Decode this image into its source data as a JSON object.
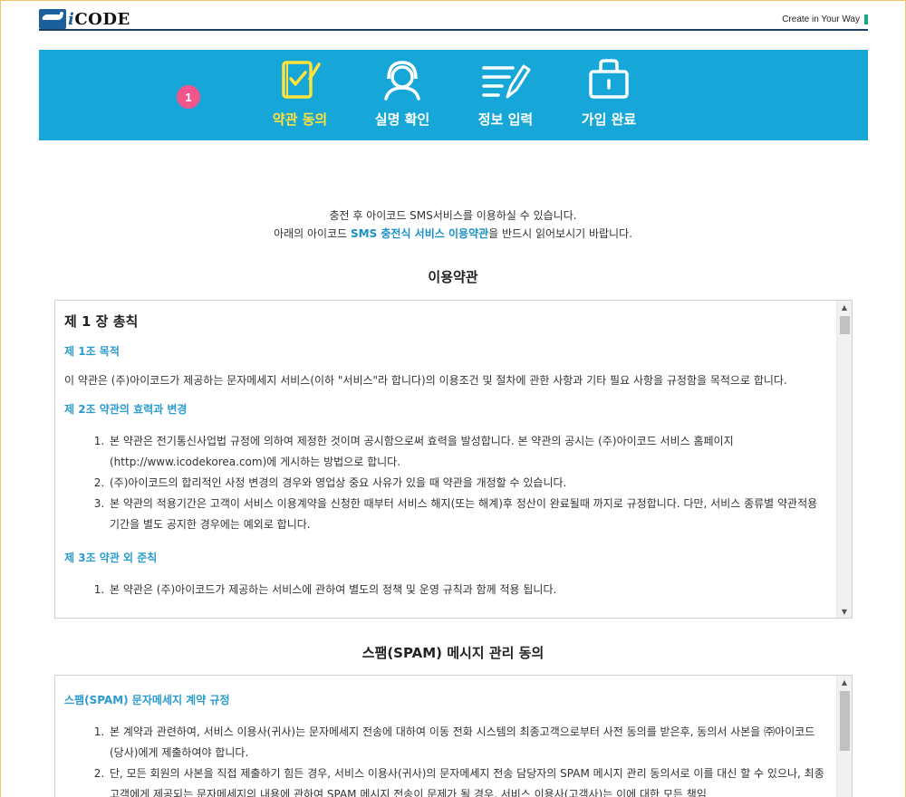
{
  "header": {
    "logo_i": "i",
    "logo_text": "CODE",
    "tagline": "Create in Your Way"
  },
  "steps": {
    "current_badge": "1",
    "items": [
      {
        "label": "약관 동의",
        "icon": "checklist-icon",
        "active": true
      },
      {
        "label": "실명 확인",
        "icon": "user-headset-icon",
        "active": false
      },
      {
        "label": "정보 입력",
        "icon": "edit-lines-icon",
        "active": false
      },
      {
        "label": "가입 완료",
        "icon": "lock-icon",
        "active": false
      }
    ],
    "active_color": "#ffe23a",
    "banner_color": "#17a6d8"
  },
  "intro": {
    "line1": "충전 후 아이코드 SMS서비스를 이용하실 수 있습니다.",
    "line2_pre": "아래의 아이코드 ",
    "line2_highlight": "SMS 충전식 서비스 이용약관",
    "line2_post": "을 반드시 읽어보시기 바랍니다."
  },
  "terms": {
    "title": "이용약관",
    "chapter": "제 1 장 총칙",
    "article1_title": "제 1조 목적",
    "article1_body": "이 약관은 (주)아이코드가 제공하는 문자메세지 서비스(이하 \"서비스\"라 합니다)의 이용조건 및 절차에 관한 사항과 기타 필요 사항을 규정함을 목적으로 합니다.",
    "article2_title": "제 2조 약관의 효력과 변경",
    "article2_items": [
      "본 약관은 전기통신사업법 규정에 의하여 제정한 것이며 공시함으로써 효력을 발성합니다. 본 약관의 공시는 (주)아이코드 서비스 홈페이지(http://www.icodekorea.com)에 게시하는 방법으로 합니다.",
      "(주)아이코드의 합리적인 사정 변경의 경우와 영업상 중요 사유가 있을 때 약관을 개정할 수 있습니다.",
      "본 약관의 적용기간은 고객이 서비스 이용계약을 신청한 때부터 서비스 해지(또는 해계)후 정산이 완료될때 까지로 규정합니다. 다만, 서비스 종류별 약관적용 기간을 별도 공지한 경우에는 예외로 합니다."
    ],
    "article3_title": "제 3조 약관 외 준칙",
    "article3_items": [
      "본 약관은 (주)아이코드가 제공하는 서비스에 관하여 별도의 정책 및 운영 규칙과 함께 적용 됩니다."
    ]
  },
  "spam": {
    "title": "스팸(SPAM) 메시지 관리 동의",
    "article_title": "스팸(SPAM) 문자메세지 계약 규정",
    "items": [
      "본 계약과 관련하여, 서비스 이용사(귀사)는 문자메세지 전송에 대하여 이동 전화 시스템의 최종고객으로부터 사전 동의를 받은후, 동의서 사본을 ㈜아이코드(당사)에게 제출하여야 합니다.",
      "단, 모든 회원의 사본을 직접 제출하기 힘든 경우, 서비스 이용사(귀사)의 문자메세지 전송 담당자의 SPAM 메시지 관리 동의서로 이를 대신 할 수 있으나, 최종고객에게 제공되는 문자메세지의 내용에 관하여 SPAM 메시지 전송이 문제가 될 경우, 서비스 이용사(고객사)는 이에 대한 모든 책임"
    ]
  }
}
